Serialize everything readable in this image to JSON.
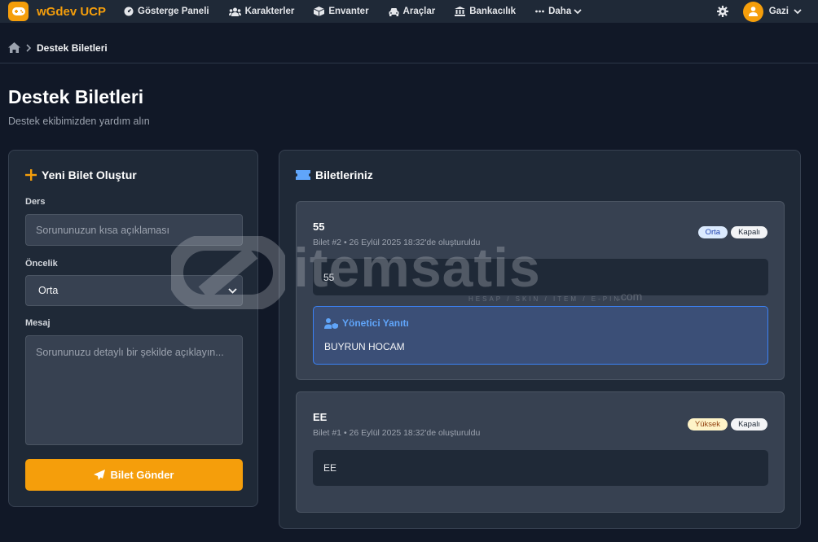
{
  "brand": {
    "name": "wGdev UCP"
  },
  "nav": {
    "items": [
      {
        "label": "Gösterge Paneli",
        "icon": "dashboard-icon"
      },
      {
        "label": "Karakterler",
        "icon": "users-icon"
      },
      {
        "label": "Envanter",
        "icon": "box-icon"
      },
      {
        "label": "Araçlar",
        "icon": "car-icon"
      },
      {
        "label": "Bankacılık",
        "icon": "bank-icon"
      },
      {
        "label": "Daha",
        "icon": "ellipsis-icon"
      }
    ],
    "user": "Gazi"
  },
  "breadcrumb": {
    "current": "Destek Biletleri"
  },
  "page": {
    "title": "Destek Biletleri",
    "subtitle": "Destek ekibimizden yardım alın"
  },
  "new_ticket": {
    "title": "Yeni Bilet Oluştur",
    "subject_label": "Ders",
    "subject_placeholder": "Sorununuzun kısa açıklaması",
    "priority_label": "Öncelik",
    "priority_value": "Orta",
    "message_label": "Mesaj",
    "message_placeholder": "Sorununuzu detaylı bir şekilde açıklayın...",
    "submit_label": "Bilet Gönder"
  },
  "tickets": {
    "title": "Biletleriniz",
    "items": [
      {
        "title": "55",
        "meta": "Bilet #2 • 26 Eylül 2025 18:32'de oluşturuldu",
        "priority": "Orta",
        "status": "Kapalı",
        "message": "55",
        "reply_label": "Yönetici Yanıtı",
        "reply_text": "BUYRUN HOCAM"
      },
      {
        "title": "EE",
        "meta": "Bilet #1 • 26 Eylül 2025 18:32'de oluşturuldu",
        "priority": "Yüksek",
        "status": "Kapalı",
        "message": "EE"
      }
    ]
  },
  "watermark": {
    "text": "itemsatis",
    "sub": "HESAP / SKIN / ITEM / E-PIN",
    "suffix": ".com"
  },
  "colors": {
    "accent": "#f59e0b",
    "link": "#60a5fa",
    "background": "#111827",
    "card": "#1f2937"
  }
}
